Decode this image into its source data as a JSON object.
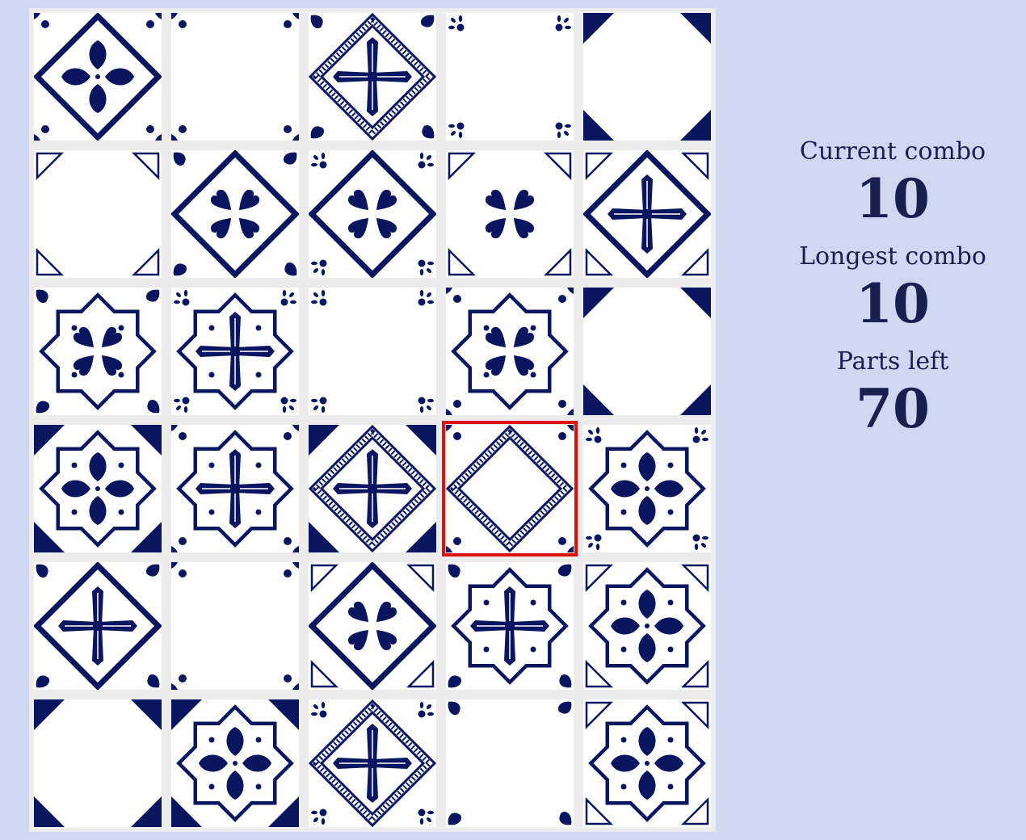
{
  "stats": {
    "current_combo_label": "Current combo",
    "current_combo": "10",
    "longest_combo_label": "Longest combo",
    "longest_combo": "10",
    "parts_left_label": "Parts left",
    "parts_left": "70"
  },
  "colors": {
    "ink": "#0a1560",
    "tile_bg": "#ffffff",
    "board_bg": "#ececec",
    "page_bg": "#cfd8f0",
    "selection": "#e0100f",
    "label_text": "#182050"
  },
  "grid": {
    "rows": 6,
    "cols": 5,
    "selected_cell": [
      3,
      3
    ],
    "tiles": [
      [
        {
          "corner": "dot-heart",
          "frame": "diamond",
          "center": "petals4"
        },
        {
          "corner": "dot-heart",
          "frame": "none",
          "center": "none"
        },
        {
          "corner": "heart",
          "frame": "diamond-ladder",
          "center": "cross"
        },
        {
          "corner": "floret",
          "frame": "none",
          "center": "none"
        },
        {
          "corner": "triangle",
          "frame": "none",
          "center": "none"
        }
      ],
      [
        {
          "corner": "triangle-outline",
          "frame": "none",
          "center": "none"
        },
        {
          "corner": "heart",
          "frame": "diamond",
          "center": "hearts4"
        },
        {
          "corner": "floret",
          "frame": "diamond",
          "center": "hearts4"
        },
        {
          "corner": "triangle-outline",
          "frame": "none",
          "center": "hearts4"
        },
        {
          "corner": "triangle-outline",
          "frame": "diamond",
          "center": "cross"
        }
      ],
      [
        {
          "corner": "heart",
          "frame": "star",
          "center": "hearts4"
        },
        {
          "corner": "floret",
          "frame": "star",
          "center": "cross"
        },
        {
          "corner": "floret",
          "frame": "none",
          "center": "none"
        },
        {
          "corner": "dot-heart",
          "frame": "star",
          "center": "hearts4"
        },
        {
          "corner": "triangle",
          "frame": "none",
          "center": "none"
        }
      ],
      [
        {
          "corner": "triangle",
          "frame": "star",
          "center": "petals4"
        },
        {
          "corner": "dot-heart",
          "frame": "star",
          "center": "cross"
        },
        {
          "corner": "triangle",
          "frame": "diamond-ladder",
          "center": "cross"
        },
        {
          "corner": "dot-heart",
          "frame": "diamond-ladder",
          "center": "none"
        },
        {
          "corner": "floret",
          "frame": "star",
          "center": "petals4"
        }
      ],
      [
        {
          "corner": "heart",
          "frame": "diamond",
          "center": "cross"
        },
        {
          "corner": "dot-heart",
          "frame": "none",
          "center": "none"
        },
        {
          "corner": "triangle-outline",
          "frame": "diamond",
          "center": "hearts4"
        },
        {
          "corner": "heart",
          "frame": "star",
          "center": "cross"
        },
        {
          "corner": "triangle-outline",
          "frame": "star",
          "center": "petals4"
        }
      ],
      [
        {
          "corner": "triangle",
          "frame": "none",
          "center": "none"
        },
        {
          "corner": "triangle",
          "frame": "star",
          "center": "petals4"
        },
        {
          "corner": "floret",
          "frame": "diamond-ladder",
          "center": "cross"
        },
        {
          "corner": "heart",
          "frame": "none",
          "center": "none"
        },
        {
          "corner": "triangle-outline",
          "frame": "star",
          "center": "petals4"
        }
      ]
    ]
  }
}
